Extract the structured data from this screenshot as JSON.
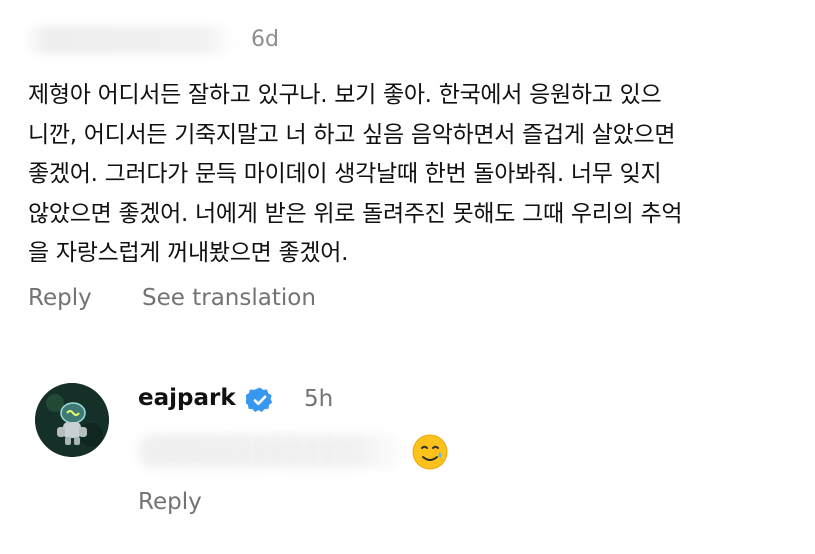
{
  "comment": {
    "time": "6d",
    "lines": [
      "제형아 어디서든 잘하고 있구나. 보기 좋아. 한국에서 응원하고 있으",
      "니깐, 어디서든 기죽지말고 너 하고 싶음 음악하면서 즐겁게 살았으면",
      "좋겠어. 그러다가 문득 마이데이 생각날때 한번 돌아봐줘. 너무 잊지",
      "않았으면 좋겠어. 너에게 받은 위로 돌려주진 못해도 그때 우리의 추억",
      "을 자랑스럽게 꺼내봤으면 좋겠어."
    ],
    "reply_label": "Reply",
    "see_translation_label": "See translation"
  },
  "reply": {
    "username": "eajpark",
    "time": "5h",
    "emoji_icon": "smiling-face-with-tear-icon",
    "reply_label": "Reply"
  },
  "colors": {
    "text": "#111111",
    "secondary": "#737373",
    "verified": "#3897f0"
  }
}
